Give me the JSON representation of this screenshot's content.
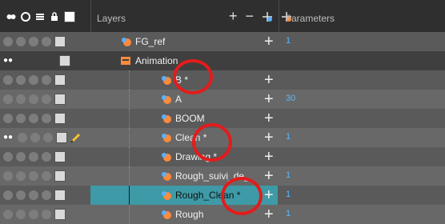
{
  "header": {
    "layers_label": "Layers",
    "parameters_label": "Parameters",
    "add_icon": "plus-icon",
    "remove_icon": "minus-icon",
    "add_peg_icon": "add-peg-icon",
    "add_drawing_icon": "add-drawing-icon"
  },
  "layers": [
    {
      "name": "FG_ref",
      "param": "1",
      "type": "drawing"
    },
    {
      "name": "Animation",
      "param": "",
      "type": "group"
    },
    {
      "name": "B *",
      "param": "",
      "type": "drawing"
    },
    {
      "name": "A",
      "param": "30",
      "type": "drawing"
    },
    {
      "name": "BOOM",
      "param": "",
      "type": "drawing"
    },
    {
      "name": "Clean *",
      "param": "1",
      "type": "drawing"
    },
    {
      "name": "Drawing *",
      "param": "",
      "type": "drawing"
    },
    {
      "name": "Rough_suivi_de_",
      "param": "1",
      "type": "drawing"
    },
    {
      "name": "Rough_Clean *",
      "param": "1",
      "type": "drawing",
      "selected": true
    },
    {
      "name": "Rough",
      "param": "1",
      "type": "drawing"
    }
  ],
  "colors": {
    "selection": "#3e9aa6",
    "param_text": "#58b7ff",
    "annotation_ring": "#e21c1c"
  }
}
